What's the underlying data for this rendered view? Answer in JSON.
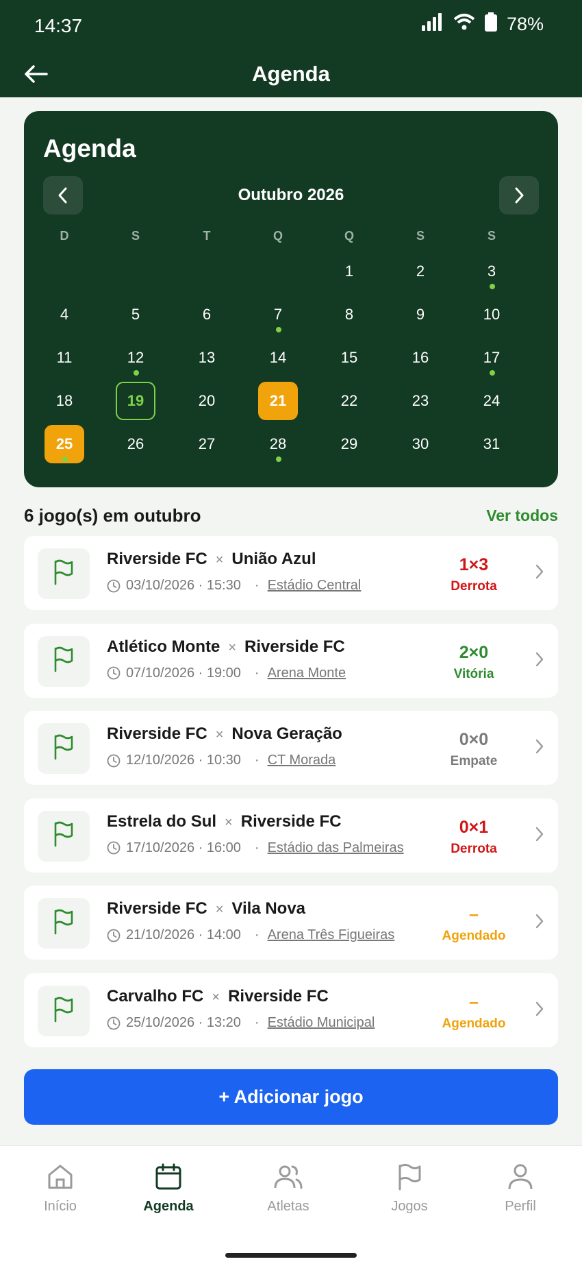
{
  "status_bar": {
    "time": "14:37",
    "battery": "78%"
  },
  "header": {
    "title": "Agenda"
  },
  "calendar": {
    "heading": "Agenda",
    "month_label": "Outubro 2026",
    "weekdays": [
      "D",
      "S",
      "T",
      "Q",
      "Q",
      "S",
      "S"
    ],
    "first_weekday_index": 4,
    "days_in_month": 31,
    "game_days": [
      3,
      7,
      12,
      17,
      25,
      28
    ],
    "today": 19,
    "highlighted": [
      21,
      25
    ],
    "colors": {
      "background": "#133a23",
      "dot": "#7fd14a",
      "highlight": "#f0a30a"
    }
  },
  "list": {
    "count_label": "6 jogo(s) em outubro",
    "see_all_label": "Ver todos",
    "matches": [
      {
        "home": "Riverside FC",
        "away": "União Azul",
        "datetime": "03/10/2026 · 15:30",
        "venue": "Estádio Central",
        "score": "1×3",
        "result": "Derrota",
        "status": "lost"
      },
      {
        "home": "Atlético Monte",
        "away": "Riverside FC",
        "datetime": "07/10/2026 · 19:00",
        "venue": "Arena Monte",
        "score": "2×0",
        "result": "Vitória",
        "status": "won"
      },
      {
        "home": "Riverside FC",
        "away": "Nova Geração",
        "datetime": "12/10/2026 · 10:30",
        "venue": "CT Morada",
        "score": "0×0",
        "result": "Empate",
        "status": "draw"
      },
      {
        "home": "Estrela do Sul",
        "away": "Riverside FC",
        "datetime": "17/10/2026 · 16:00",
        "venue": "Estádio das Palmeiras",
        "score": "0×1",
        "result": "Derrota",
        "status": "lost"
      },
      {
        "home": "Riverside FC",
        "away": "Vila Nova",
        "datetime": "21/10/2026 · 14:00",
        "venue": "Arena Três Figueiras",
        "score": "–",
        "result": "Agendado",
        "status": "sched"
      },
      {
        "home": "Carvalho FC",
        "away": "Riverside FC",
        "datetime": "25/10/2026 · 13:20",
        "venue": "Estádio Municipal",
        "score": "–",
        "result": "Agendado",
        "status": "sched"
      }
    ],
    "versus_symbol": "×",
    "meta_separator": "·"
  },
  "add_button": {
    "label": "+ Adicionar jogo",
    "color": "#1b63f0"
  },
  "bottom_nav": {
    "items": [
      {
        "label": "Início",
        "icon": "home-icon"
      },
      {
        "label": "Agenda",
        "icon": "calendar-icon"
      },
      {
        "label": "Atletas",
        "icon": "users-icon"
      },
      {
        "label": "Jogos",
        "icon": "flag-icon"
      },
      {
        "label": "Perfil",
        "icon": "person-icon"
      }
    ],
    "active": "Agenda"
  }
}
